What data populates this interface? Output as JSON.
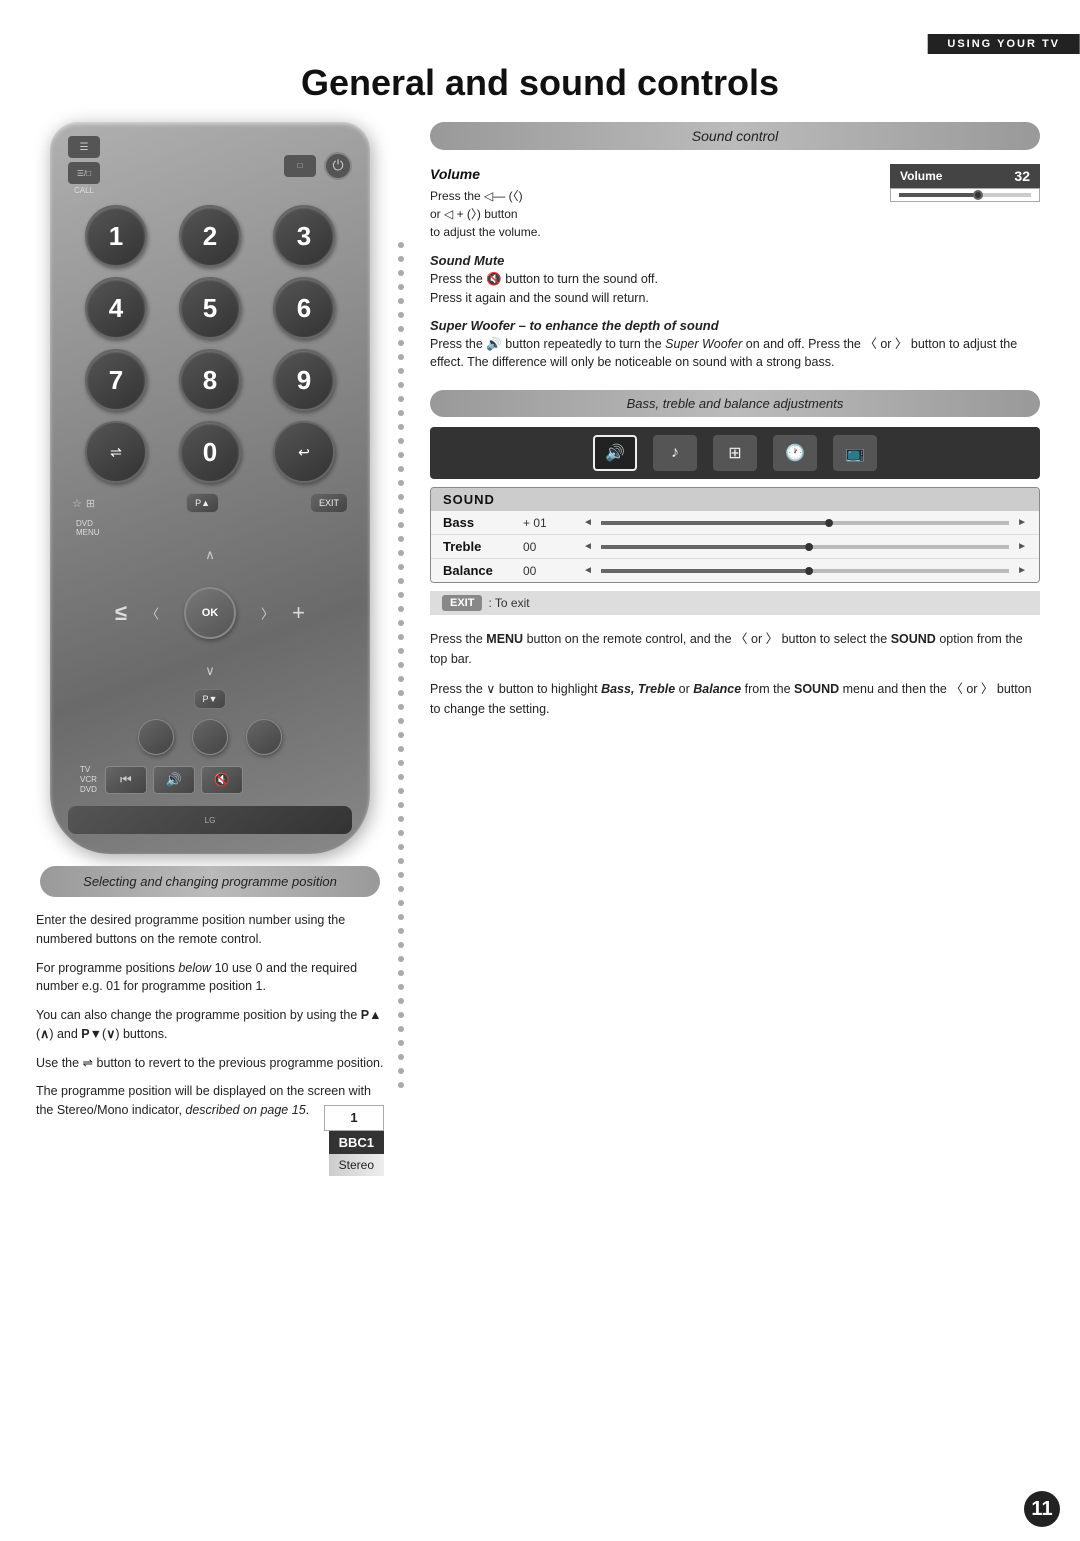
{
  "header": {
    "bar_label": "Using Your TV",
    "page_title": "General and sound controls"
  },
  "left": {
    "selecting_banner": "Selecting and changing programme position",
    "text1": "Enter the desired programme position number using the numbered buttons on the remote control.",
    "text2": "For programme positions below 10 use 0 and the required number e.g. 01 for programme position 1.",
    "text3": "You can also change the programme position by using the P▲ (∧) and P▼(∨) buttons.",
    "text4": "Use the ⇌ button to revert to the previous programme position.",
    "text5": "The programme position will be displayed on the screen with the Stereo/Mono indicator, described on page 15.",
    "prog_num": "1",
    "prog_bbc1": "BBC1",
    "prog_stereo": "Stereo"
  },
  "remote": {
    "call_label": "CALL",
    "ok_label": "OK",
    "menu_label": "MENU",
    "dvd_menu_label": "DVD\nMENU",
    "exit_label": "EXIT",
    "p_up_label": "P▲",
    "p_down_label": "P▼",
    "numbers": [
      "1",
      "2",
      "3",
      "4",
      "5",
      "6",
      "7",
      "8",
      "9"
    ],
    "zero": "0",
    "tv_label": "TV",
    "vcr_label": "VCR",
    "dvd_label": "DVD"
  },
  "right": {
    "sound_control_header": "Sound control",
    "volume_label": "Volume",
    "volume_value": "32",
    "volume_desc1": "Press the",
    "volume_desc2": "— (〈) or",
    "volume_desc3": "+ (〉) button to adjust the volume.",
    "sound_mute_label": "Sound Mute",
    "sound_mute_desc": "Press the 🔇 button to turn the sound off. Press it again and the sound will return.",
    "super_woofer_label": "Super Woofer – to enhance the depth of sound",
    "super_woofer_desc": "Press the 🔊 button repeatedly to turn the Super Woofer on and off. Press the 〈 or 〉 button to adjust the effect. The difference will only be noticeable on sound with a strong bass.",
    "bass_treble_header": "Bass, treble and balance adjustments",
    "sound_table": {
      "header": "SOUND",
      "rows": [
        {
          "label": "Bass",
          "value": "+ 01",
          "slider_pos": 0.55
        },
        {
          "label": "Treble",
          "value": "00",
          "slider_pos": 0.5
        },
        {
          "label": "Balance",
          "value": "00",
          "slider_pos": 0.5
        }
      ]
    },
    "exit_label": "EXIT",
    "exit_desc": ": To exit",
    "bottom_text1": "Press the MENU button on the remote control, and the 〈 or 〉 button to select the SOUND option from the top bar.",
    "bottom_text2": "Press the ∨ button to highlight Bass, Treble or Balance from the SOUND menu and then the 〈 or 〉 button to change the setting."
  },
  "page_number": "11"
}
